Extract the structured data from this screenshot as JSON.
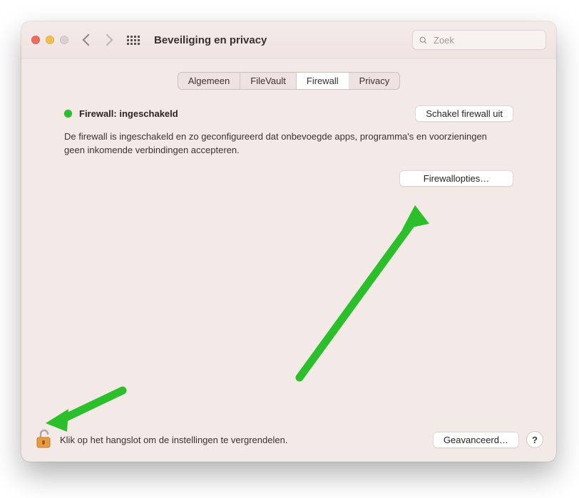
{
  "window": {
    "title": "Beveiliging en privacy"
  },
  "search": {
    "placeholder": "Zoek"
  },
  "tabs": [
    {
      "label": "Algemeen",
      "active": false
    },
    {
      "label": "FileVault",
      "active": false
    },
    {
      "label": "Firewall",
      "active": true
    },
    {
      "label": "Privacy",
      "active": false
    }
  ],
  "firewall": {
    "status_label": "Firewall: ingeschakeld",
    "status_color": "#2bbf2b",
    "toggle_button": "Schakel firewall uit",
    "description": "De firewall is ingeschakeld en zo geconfigureerd dat onbevoegde apps, programma's en voorzieningen geen inkomende verbindingen accepteren.",
    "options_button": "Firewallopties…"
  },
  "bottom": {
    "lock_hint": "Klik op het hangslot om de instellingen te vergrendelen.",
    "advanced_button": "Geavanceerd…",
    "help_label": "?"
  },
  "colors": {
    "annotation_green": "#2bbf2b"
  }
}
